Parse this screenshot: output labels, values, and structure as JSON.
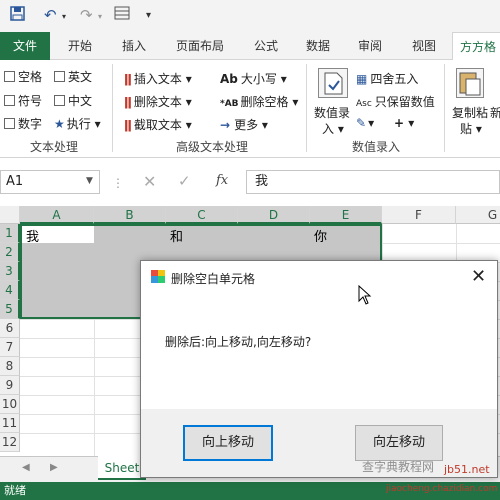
{
  "qat": {
    "save_icon": "save-icon",
    "undo_icon": "undo-icon",
    "redo_icon": "redo-icon",
    "customize": "▾"
  },
  "tabs": [
    "文件",
    "开始",
    "插入",
    "页面布局",
    "公式",
    "数据",
    "审阅",
    "视图",
    "方方格"
  ],
  "ribbon": {
    "group1": {
      "items": [
        "空格",
        "英文",
        "符号",
        "中文",
        "数字",
        "执行 ▾"
      ],
      "label": "文本处理"
    },
    "group2": {
      "items": [
        "插入文本 ▾",
        "删除文本 ▾",
        "截取文本 ▾",
        "大小写 ▾",
        "删除空格 ▾",
        "更多 ▾"
      ],
      "label": "高级文本处理"
    },
    "group3": {
      "items": [
        "数值录",
        "入 ▾",
        "四舍五入",
        "只保留数值",
        "▾",
        "+ ▾"
      ],
      "label": "数值录入"
    },
    "group4": {
      "items": [
        "复制粘",
        "贴 ▾",
        "新"
      ]
    }
  },
  "formula_bar": {
    "name_box": "A1",
    "value": "我",
    "fx": "fx"
  },
  "grid": {
    "columns": [
      "A",
      "B",
      "C",
      "D",
      "E",
      "F",
      "G"
    ],
    "rows": [
      "1",
      "2",
      "3",
      "4",
      "5",
      "6",
      "7",
      "8",
      "9",
      "10",
      "11",
      "12"
    ],
    "cells": {
      "A1": "我",
      "C1": "和",
      "E1": "你"
    }
  },
  "sheet_tab": "Sheet",
  "status": "就绪",
  "dialog": {
    "title": "删除空白单元格",
    "message": "删除后:向上移动,向左移动?",
    "button_up": "向上移动",
    "button_left": "向左移动"
  },
  "watermark": {
    "line1": "查字典教程网",
    "line2": "jb51.net",
    "line3": "jiaocheng.chazidian.com"
  },
  "colors": {
    "excel_green": "#217346",
    "selection_gray": "#c6c6c6",
    "focus_blue": "#0078d7"
  }
}
